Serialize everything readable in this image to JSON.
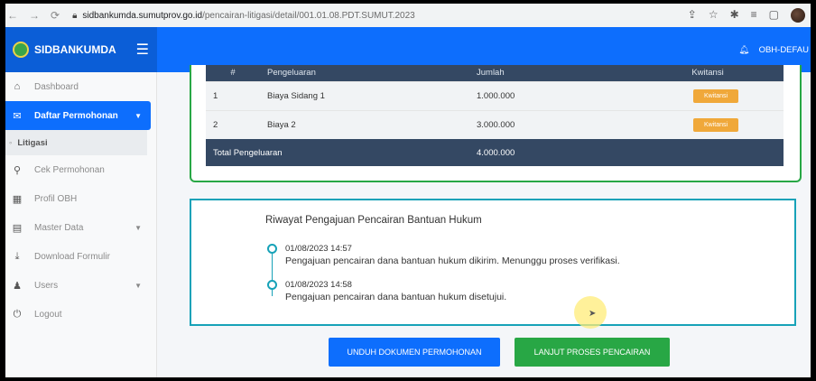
{
  "browser": {
    "url_host": "sidbankumda.sumutprov.go.id",
    "url_path": "/pencairan-litigasi/detail/001.01.08.PDT.SUMUT.2023"
  },
  "header": {
    "brand": "SIDBANKUMDA",
    "user": "OBH-DEFAU"
  },
  "sidebar": {
    "items": [
      {
        "label": "Dashboard",
        "icon": "home-icon"
      },
      {
        "label": "Daftar Permohonan",
        "icon": "envelope-icon",
        "active": true
      },
      {
        "label": "Cek Permohonan",
        "icon": "search-icon"
      },
      {
        "label": "Profil OBH",
        "icon": "grid-icon"
      },
      {
        "label": "Master Data",
        "icon": "database-icon"
      },
      {
        "label": "Download Formulir",
        "icon": "download-icon"
      },
      {
        "label": "Users",
        "icon": "user-icon"
      },
      {
        "label": "Logout",
        "icon": "power-icon"
      }
    ],
    "sub_item": "Litigasi"
  },
  "table": {
    "headers": [
      "#",
      "Pengeluaran",
      "Jumlah",
      "Kwitansi"
    ],
    "rows": [
      {
        "no": "1",
        "name": "Biaya Sidang 1",
        "amount": "1.000.000",
        "btn": "Kwitansi"
      },
      {
        "no": "2",
        "name": "Biaya 2",
        "amount": "3.000.000",
        "btn": "Kwitansi"
      }
    ],
    "total_label": "Total Pengeluaran",
    "total_value": "4.000.000"
  },
  "history": {
    "title": "Riwayat Pengajuan Pencairan Bantuan Hukum",
    "items": [
      {
        "date": "01/08/2023 14:57",
        "text": "Pengajuan pencairan dana bantuan hukum dikirim. Menunggu proses verifikasi."
      },
      {
        "date": "01/08/2023 14:58",
        "text": "Pengajuan pencairan dana bantuan hukum disetujui."
      }
    ]
  },
  "buttons": {
    "download": "UNDUH DOKUMEN PERMOHONAN",
    "continue": "LANJUT PROSES PENCAIRAN"
  },
  "colors": {
    "primary": "#0d6efd",
    "success": "#28a745",
    "info": "#17a2b8",
    "table_dark": "#344863",
    "warning": "#f0a83a"
  }
}
